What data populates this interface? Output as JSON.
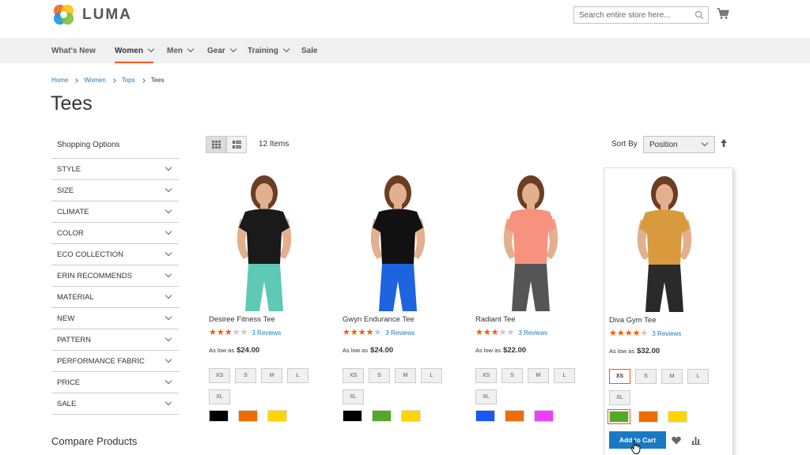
{
  "header": {
    "logo_text": "LUMA",
    "search_placeholder": "Search entire store here...",
    "colors": {
      "accent": "#ff5501",
      "link": "#1979c3",
      "button": "#1979c3"
    }
  },
  "nav": {
    "items": [
      {
        "label": "What's New",
        "has_menu": false
      },
      {
        "label": "Women",
        "has_menu": true,
        "active": true
      },
      {
        "label": "Men",
        "has_menu": true
      },
      {
        "label": "Gear",
        "has_menu": true
      },
      {
        "label": "Training",
        "has_menu": true
      },
      {
        "label": "Sale",
        "has_menu": false
      }
    ]
  },
  "breadcrumb": [
    "Home",
    "Women",
    "Tops",
    "Tees"
  ],
  "page_title": "Tees",
  "sidebar": {
    "title": "Shopping Options",
    "filters": [
      "STYLE",
      "SIZE",
      "CLIMATE",
      "COLOR",
      "ECO COLLECTION",
      "ERIN RECOMMENDS",
      "MATERIAL",
      "NEW",
      "PATTERN",
      "PERFORMANCE FABRIC",
      "PRICE",
      "SALE"
    ],
    "compare_title": "Compare Products"
  },
  "toolbar": {
    "item_count": "12 Items",
    "sort_label": "Sort By",
    "sort_value": "Position"
  },
  "products": [
    {
      "name": "Desiree Fitness Tee",
      "rating": 3,
      "reviews": "3 Reviews",
      "price_prefix": "As low as",
      "price": "$24.00",
      "sizes": [
        "XS",
        "S",
        "M",
        "L",
        "XL"
      ],
      "colors": [
        "#000000",
        "#ef6c00",
        "#ffd500"
      ],
      "shirt_color": "#1a1a1a",
      "bottom_color": "#5fc9b5"
    },
    {
      "name": "Gwyn Endurance Tee",
      "rating": 4,
      "reviews": "3 Reviews",
      "price_prefix": "As low as",
      "price": "$24.00",
      "sizes": [
        "XS",
        "S",
        "M",
        "L",
        "XL"
      ],
      "colors": [
        "#000000",
        "#53a828",
        "#ffd500"
      ],
      "shirt_color": "#111111",
      "bottom_color": "#1d64e0"
    },
    {
      "name": "Radiant Tee",
      "rating": 3,
      "reviews": "3 Reviews",
      "price_prefix": "As low as",
      "price": "$22.00",
      "sizes": [
        "XS",
        "S",
        "M",
        "L",
        "XL"
      ],
      "colors": [
        "#1857f7",
        "#ef6c00",
        "#ef3dff"
      ],
      "shirt_color": "#f7927f",
      "bottom_color": "#555555"
    },
    {
      "name": "Diva Gym Tee",
      "rating": 4,
      "reviews": "3 Reviews",
      "price_prefix": "As low as",
      "price": "$32.00",
      "sizes": [
        "XS",
        "S",
        "M",
        "L",
        "XL"
      ],
      "colors": [
        "#53a828",
        "#ef6c00",
        "#ffd500"
      ],
      "shirt_color": "#d89a3c",
      "bottom_color": "#2a2a2a",
      "add_to_cart": "Add to Cart"
    }
  ]
}
